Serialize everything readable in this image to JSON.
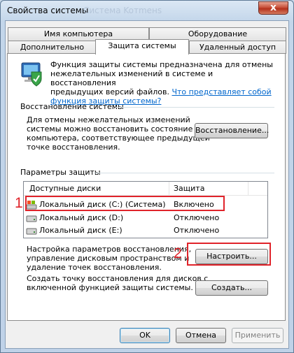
{
  "window": {
    "title": "Свойства системы",
    "ghost_title": "Система     Koтmeнs",
    "close_glyph": "x"
  },
  "tabs": {
    "row_top": [
      "Имя компьютера",
      "Оборудование"
    ],
    "row_bottom": [
      "Дополнительно",
      "Защита системы",
      "Удаленный доступ"
    ],
    "active": "Защита системы"
  },
  "intro": {
    "text": "Функция защиты системы предназначена для отмены нежелательных изменений в системе и восстановления предыдущих версий файлов.",
    "line1": "Функция защиты системы предназначена для отмены",
    "line2": "нежелательных изменений в системе и восстановления",
    "line3_plain": "предыдущих версий файлов.",
    "link_part1": "Что представляет собой",
    "link_part2": "функция защиты системы?"
  },
  "restore": {
    "heading": "Восстановление системы",
    "lines": [
      "Для отмены нежелательных изменений",
      "системы можно восстановить состояние",
      "компьютера, соответствующее предыдущей",
      "точке восстановления."
    ],
    "button": "Восстановление..."
  },
  "protection": {
    "heading": "Параметры защиты",
    "columns": [
      "Доступные диски",
      "Защита"
    ],
    "drives": [
      {
        "name": "Локальный диск (C:) (Система)",
        "status": "Включено",
        "icon": "system-drive-icon"
      },
      {
        "name": "Локальный диск (D:)",
        "status": "Отключено",
        "icon": "drive-icon"
      },
      {
        "name": "Локальный диск (E:)",
        "status": "Отключено",
        "icon": "drive-icon"
      }
    ],
    "configure_lines": [
      "Настройка параметров восстановления,",
      "управление дисковым пространством и",
      "удаление точек восстановления."
    ],
    "configure_button": "Настроить...",
    "create_lines": [
      "Создать точку восстановления для дисков с",
      "включенной функцией защиты системы."
    ],
    "create_button": "Создать..."
  },
  "annotations": {
    "marker1": "1",
    "marker2": "2",
    "color": "#e0232a"
  },
  "footer": {
    "ok": "OK",
    "cancel": "Отмена",
    "apply": "Применить"
  }
}
